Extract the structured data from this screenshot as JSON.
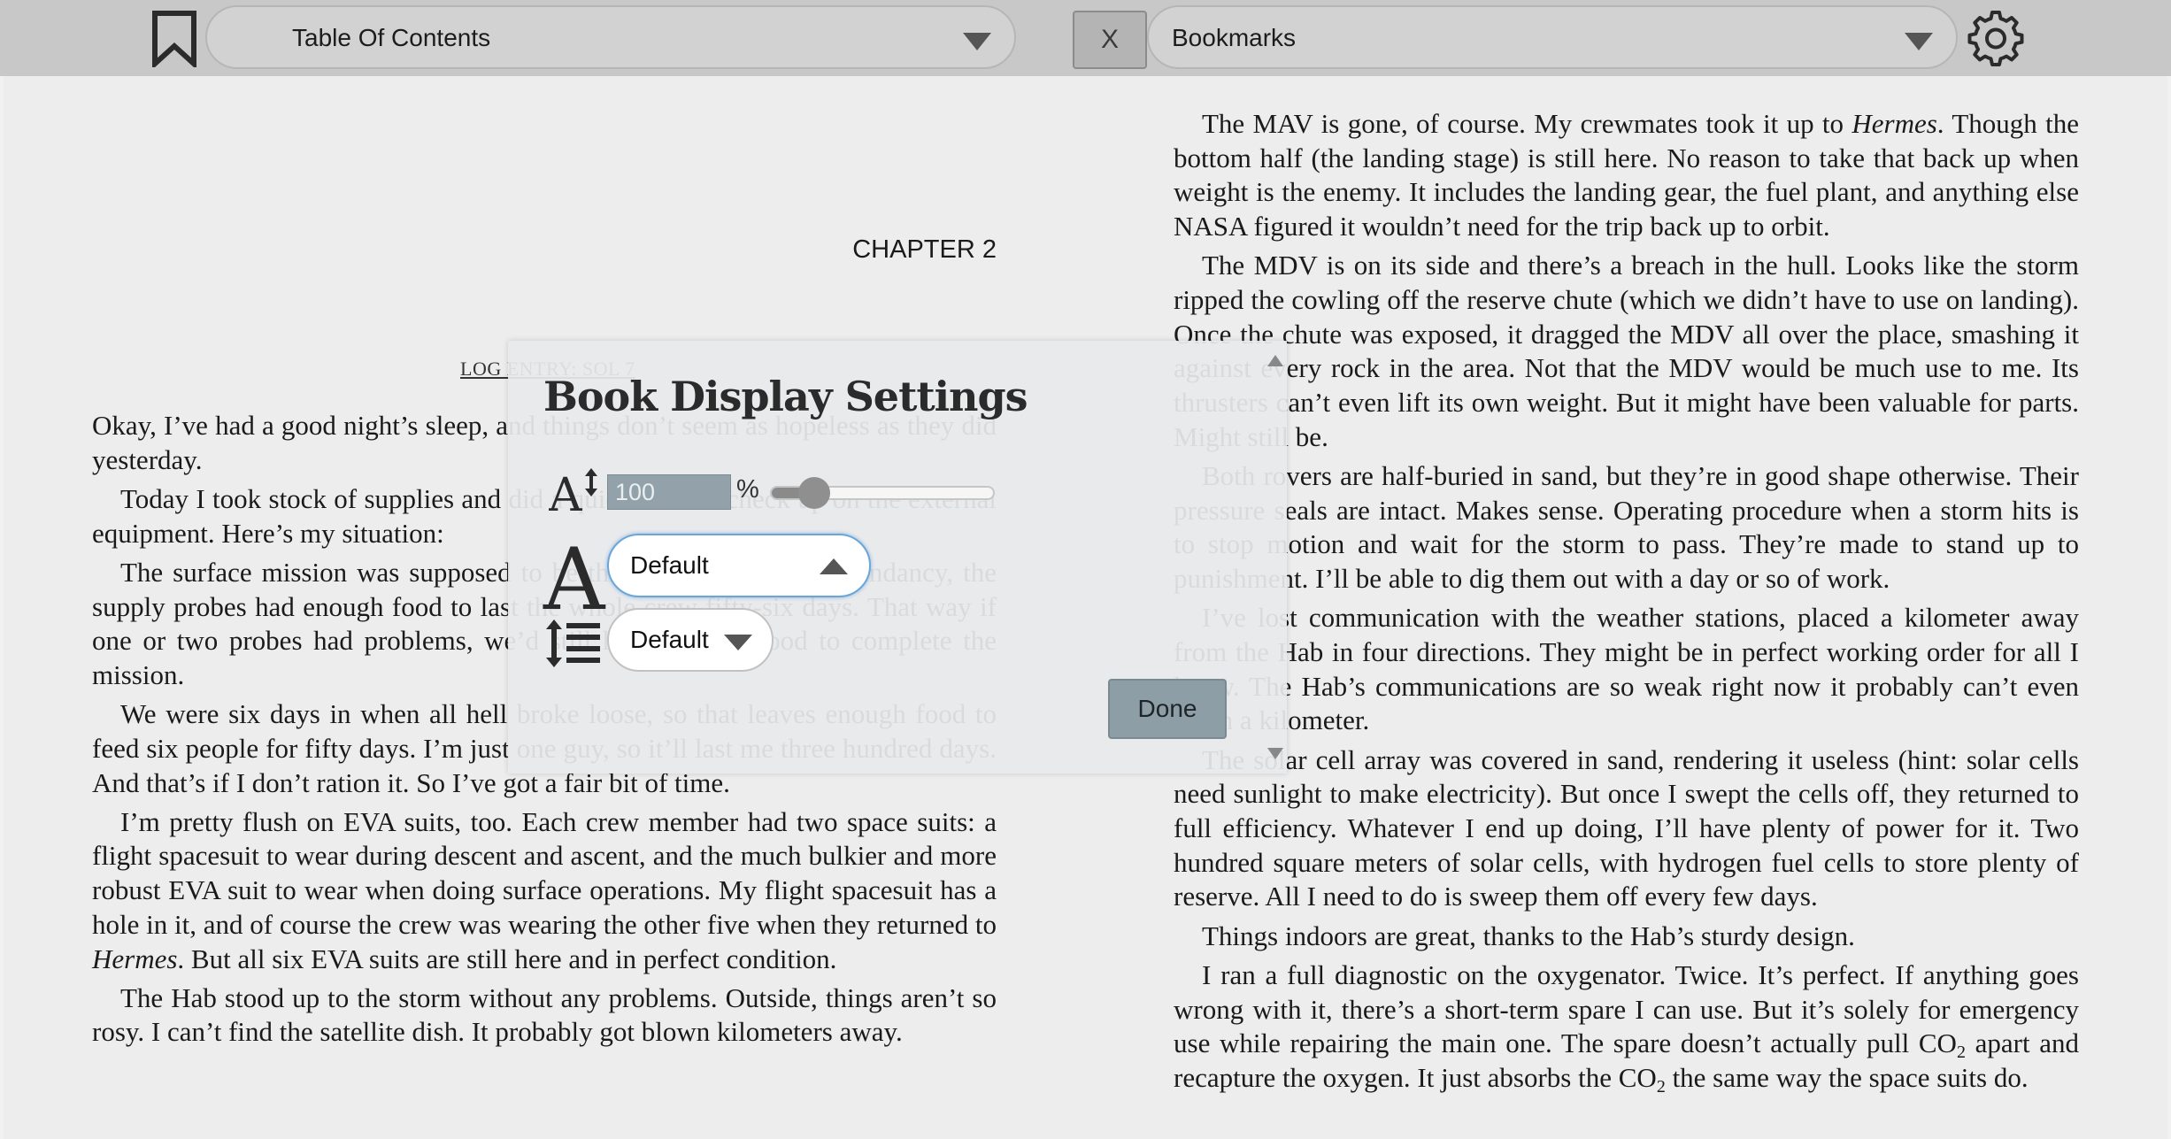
{
  "toolbar": {
    "toc_label": "Table Of Contents",
    "close_label": "X",
    "bookmarks_label": "Bookmarks",
    "icons": [
      "bookmark-icon",
      "chevron-down-icon",
      "gear-icon"
    ]
  },
  "left_page": {
    "chapter": "CHAPTER 2",
    "log_entry": "LOG ENTRY: SOL 7",
    "paragraphs": [
      {
        "text": "Okay, I’ve had a good night’s sleep, and things don’t seem as hopeless as they did yesterday."
      },
      {
        "text": "Today I took stock of supplies and did a quick EVA to check up on the external equipment. Here’s my situation:"
      },
      {
        "text": "The surface mission was supposed to be thirty-one days. For redundancy, the supply probes had enough food to last the whole crew fifty-six days. That way if one or two probes had problems, we’d still have enough food to complete the mission."
      },
      {
        "text": "We were six days in when all hell broke loose, so that leaves enough food to feed six people for fifty days. I’m just one guy, so it’ll last me three hundred days. And that’s if I don’t ration it. So I’ve got a fair bit of time."
      },
      {
        "before": "I’m pretty flush on EVA suits, too. Each crew member had two space suits: a flight spacesuit to wear during descent and ascent, and the much bulkier and more robust EVA suit to wear when doing surface operations. My flight spacesuit has a hole in it, and of course the crew was wearing the other five when they returned to ",
        "em": "Hermes",
        "after": ". But all six EVA suits are still here and in perfect condition."
      },
      {
        "text": "The Hab stood up to the storm without any problems. Outside, things aren’t so rosy. I can’t find the satellite dish. It probably got blown kilometers away."
      }
    ]
  },
  "right_page": {
    "paragraphs": [
      {
        "before": "The MAV is gone, of course. My crewmates took it up to ",
        "em": "Hermes",
        "after": ". Though the bottom half (the landing stage) is still here. No reason to take that back up when weight is the enemy. It includes the landing gear, the fuel plant, and anything else NASA figured it wouldn’t need for the trip back up to orbit."
      },
      {
        "text": "The MDV is on its side and there’s a breach in the hull. Looks like the storm ripped the cowling off the reserve chute (which we didn’t have to use on landing). Once the chute was exposed, it dragged the MDV all over the place, smashing it against every rock in the area. Not that the MDV would be much use to me. Its thrusters can’t even lift its own weight. But it might have been valuable for parts. Might still be."
      },
      {
        "text": "Both rovers are half-buried in sand, but they’re in good shape otherwise. Their pressure seals are intact. Makes sense. Operating procedure when a storm hits is to stop motion and wait for the storm to pass. They’re made to stand up to punishment. I’ll be able to dig them out with a day or so of work."
      },
      {
        "text": "I’ve lost communication with the weather stations, placed a kilometer away from the Hab in four directions. They might be in perfect working order for all I know. The Hab’s communications are so weak right now it probably can’t even reach a kilometer."
      },
      {
        "text": "The solar cell array was covered in sand, rendering it useless (hint: solar cells need sunlight to make electricity). But once I swept the cells off, they returned to full efficiency. Whatever I end up doing, I’ll have plenty of power for it. Two hundred square meters of solar cells, with hydrogen fuel cells to store plenty of reserve. All I need to do is sweep them off every few days."
      },
      {
        "text": "Things indoors are great, thanks to the Hab’s sturdy design."
      },
      {
        "p1": "I ran a full diagnostic on the oxygenator. Twice. It’s perfect. If anything goes wrong with it, there’s a short-term spare I can use. But it’s solely for emergency use while repairing the main one. The spare doesn’t actually pull CO",
        "sub1": "2",
        "p2": " apart and recapture the oxygen. It just absorbs the CO",
        "sub2": "2",
        "p3": " the same way the space suits do."
      }
    ]
  },
  "settings": {
    "title": "Book Display Settings",
    "font_size_value": "100",
    "font_size_unit": "%",
    "slider_fraction": 0.19,
    "font_family_value": "Default",
    "line_height_value": "Default",
    "done_label": "Done",
    "icons": [
      "font-size-icon",
      "font-family-icon",
      "line-height-icon",
      "chevron-up-icon",
      "chevron-down-icon"
    ]
  },
  "colors": {
    "toolbar_bg": "#c8c8c8",
    "modal_bg": "#e8eaec",
    "accent_input": "#93a2aa",
    "done_button": "#8e9ea6",
    "focus_ring": "#6aa7d8"
  }
}
